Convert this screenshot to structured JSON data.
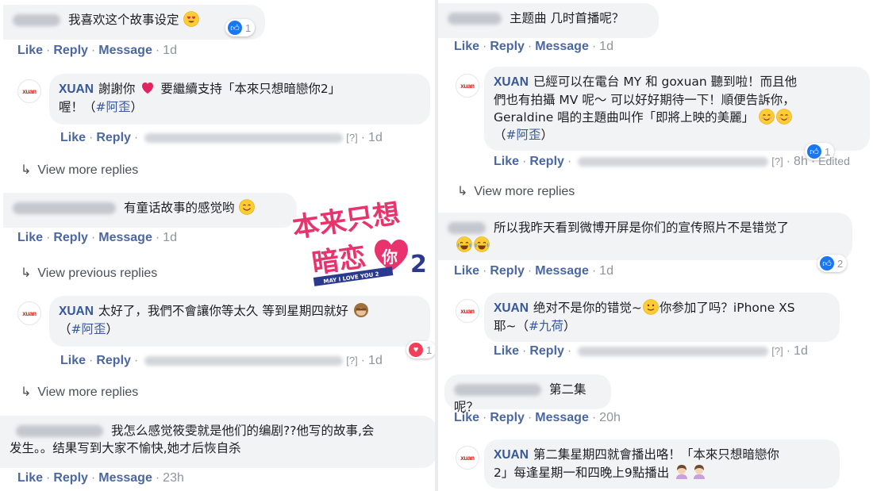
{
  "common": {
    "like": "Like",
    "reply": "Reply",
    "message": "Message",
    "view_more": "View more replies",
    "view_previous": "View previous replies",
    "avatar_text": "xuan",
    "q": "[?]"
  },
  "left": {
    "c1": {
      "text": "我喜欢这个故事设定",
      "time": "1d",
      "react_count": "1"
    },
    "r1": {
      "author": "XUAN",
      "text": "謝謝你",
      "text2": "要繼續支持「本來只想暗戀你2」",
      "text3": "喔！（",
      "tag": "#阿歪",
      "text4": "）",
      "time": "1d"
    },
    "c2": {
      "text": "有童话故事的感觉哟",
      "time": "1d"
    },
    "r2": {
      "author": "XUAN",
      "text": "太好了，我們不會讓你等太久 等到星期四就好",
      "text2": "（",
      "tag": "#阿歪",
      "text3": "）",
      "time": "1d",
      "react_count": "1"
    },
    "c3": {
      "text": "我怎么感觉筱雯就是他们的编剧??他写的故事,会",
      "text2": "发生。。结果写到大家不愉快,她才后恢自杀",
      "time": "23h"
    }
  },
  "right": {
    "c1": {
      "text": "主题曲 几时首播呢？",
      "time": "1d"
    },
    "r1": {
      "author": "XUAN",
      "line1": "已經可以在電台 MY 和 goxuan 聽到啦！而且他",
      "line2": "們也有拍攝 MV 呢～ 可以好好期待一下！順便告訴你，",
      "line3": "Geraldine 唱的主題曲叫作「即將上映的美麗」",
      "line4a": "（",
      "tag": "#阿歪",
      "line4b": "）",
      "time": "8h",
      "edited": "Edited",
      "react_count": "1"
    },
    "c2": {
      "text": "所以我昨天看到微博开屏是你们的宣传照片不是错觉了",
      "time": "1d",
      "react_count": "2"
    },
    "r2": {
      "author": "XUAN",
      "line1a": "绝对不是你的错觉~",
      "line1b": "你参加了吗？iPhone XS",
      "line2a": "耶~（",
      "tag": "#九荷",
      "line2b": "）",
      "time": "1d"
    },
    "c3": {
      "text": "第二集呢？",
      "time": "20h"
    },
    "r3": {
      "author": "XUAN",
      "line1": "第二集星期四就會播出咯！「本來只想暗戀你",
      "line2": "2」每逢星期一和四晚上9點播出"
    }
  },
  "logo": {
    "line1": "本来只想",
    "line2": "暗恋",
    "heart_text": "你",
    "num": "2",
    "tagline": "MAY I LOVE YOU 2"
  },
  "colors": {
    "link": "#4b67a1",
    "author": "#365899",
    "bubble": "#f2f3f5",
    "like_blue": "#1877f2",
    "love_red": "#f33e58",
    "logo_pink": "#e8336d",
    "logo_blue": "#2b3a8f"
  },
  "icons": [
    "thumbs-up-icon",
    "heart-icon",
    "reply-arrow-icon",
    "heart-eyes-emoji",
    "smile-emoji",
    "blush-emoji",
    "joy-emoji",
    "slight-smile-emoji",
    "monkey-emoji",
    "person-emoji"
  ]
}
